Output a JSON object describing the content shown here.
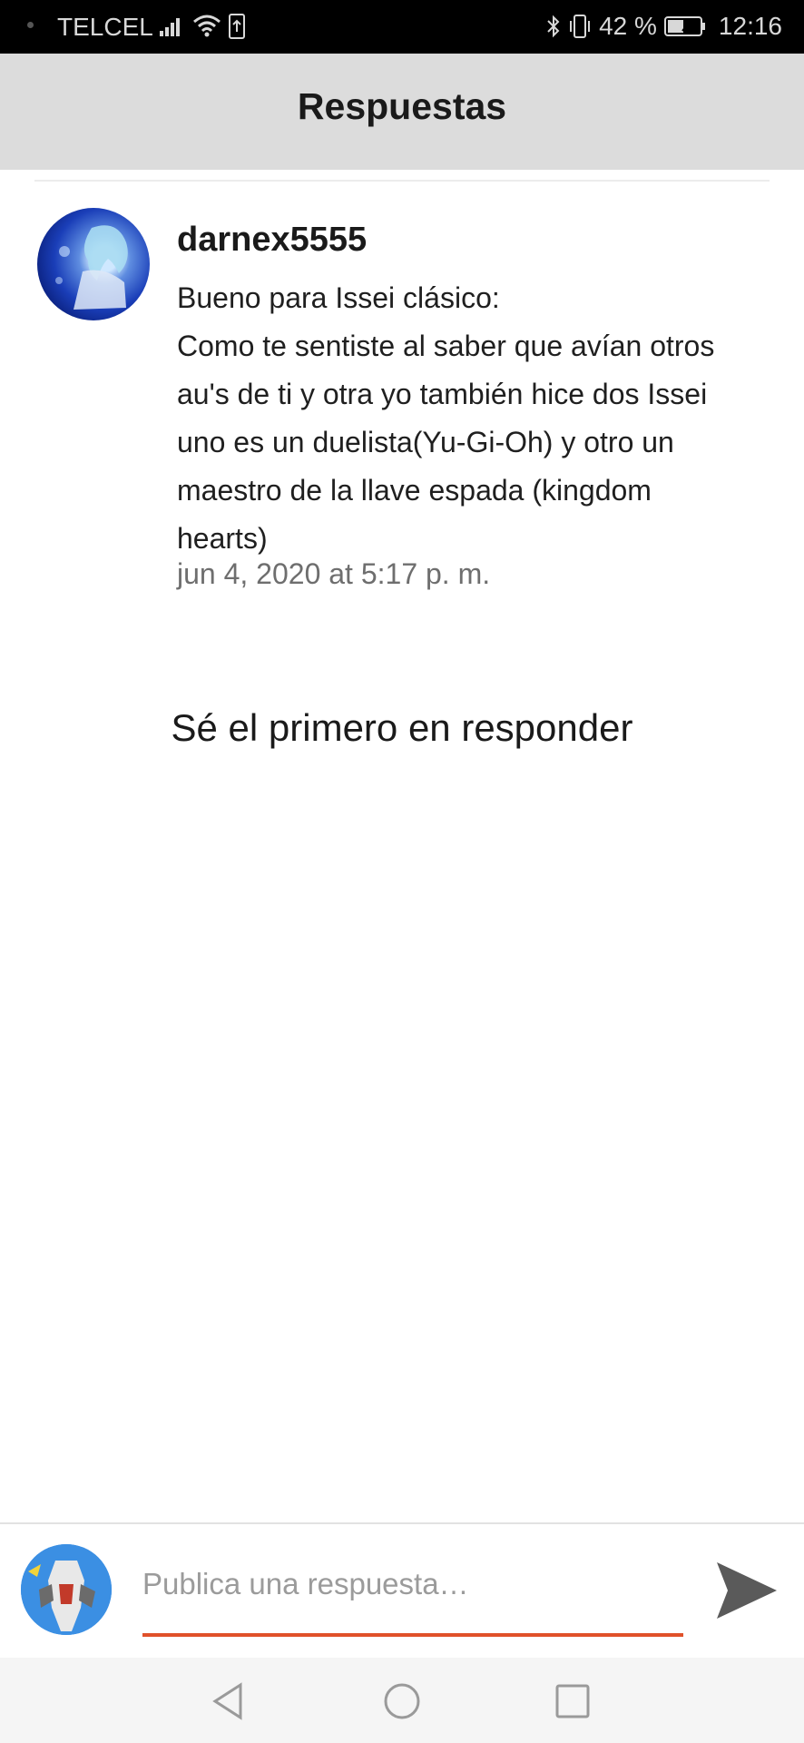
{
  "status_bar": {
    "carrier": "TELCEL",
    "battery": "42 %",
    "time": "12:16"
  },
  "header": {
    "title": "Respuestas"
  },
  "comment": {
    "author": "darnex5555",
    "body": "Bueno para Issei clásico:\nComo te sentiste al saber que avían otros\nau's de ti y otra yo también hice dos Issei\nuno es un duelista(Yu-Gi-Oh) y otro un\nmaestro de la llave espada (kingdom\nhearts)",
    "date": "jun 4, 2020 at 5:17 p. m."
  },
  "replies": {
    "empty_message": "Sé el primero en responder"
  },
  "reply_bar": {
    "placeholder": "Publica una respuesta…",
    "value": ""
  },
  "colors": {
    "header_bg": "#dcdcdc",
    "accent_underline": "#e0512a",
    "status_bar_bg": "#000000",
    "date_text": "#6e6e6e"
  }
}
